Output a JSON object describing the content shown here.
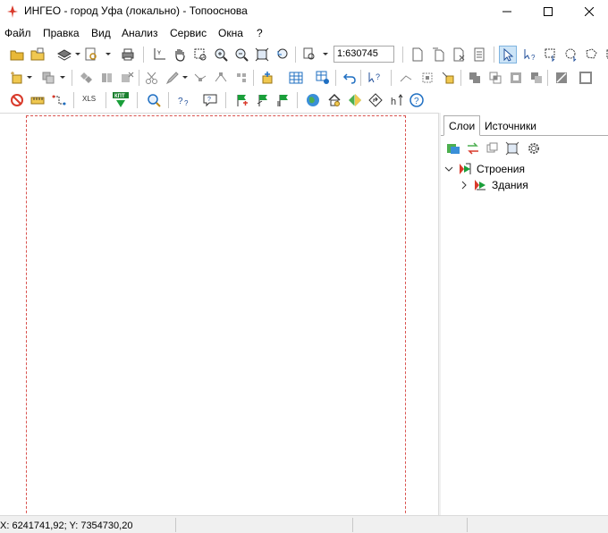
{
  "window": {
    "title": "ИНГЕО - город Уфа (локально) - Топооснова",
    "app_icon": "ingeo-logo-icon",
    "controls": [
      "minimize-icon",
      "maximize-icon",
      "close-icon"
    ]
  },
  "menu": [
    {
      "label": "Файл"
    },
    {
      "label": "Правка"
    },
    {
      "label": "Вид"
    },
    {
      "label": "Анализ"
    },
    {
      "label": "Сервис"
    },
    {
      "label": "Окна"
    },
    {
      "label": "?"
    }
  ],
  "toolbar": {
    "scale_value": "1:630745",
    "xls_label": "XLS",
    "kpt_label": "КПТ"
  },
  "panel": {
    "tabs": [
      {
        "label": "Слои",
        "selected": true
      },
      {
        "label": "Источники",
        "selected": false
      }
    ],
    "tree": [
      {
        "label": "Строения",
        "level": 0,
        "expanded": true
      },
      {
        "label": "Здания",
        "level": 1,
        "expanded": false
      }
    ]
  },
  "status": {
    "coordinates": "X: 6241741,92; Y: 7354730,20"
  },
  "colors": {
    "accent": "#d9534f",
    "selection": "#cce4f7",
    "status_bg": "#f0f0f0"
  }
}
